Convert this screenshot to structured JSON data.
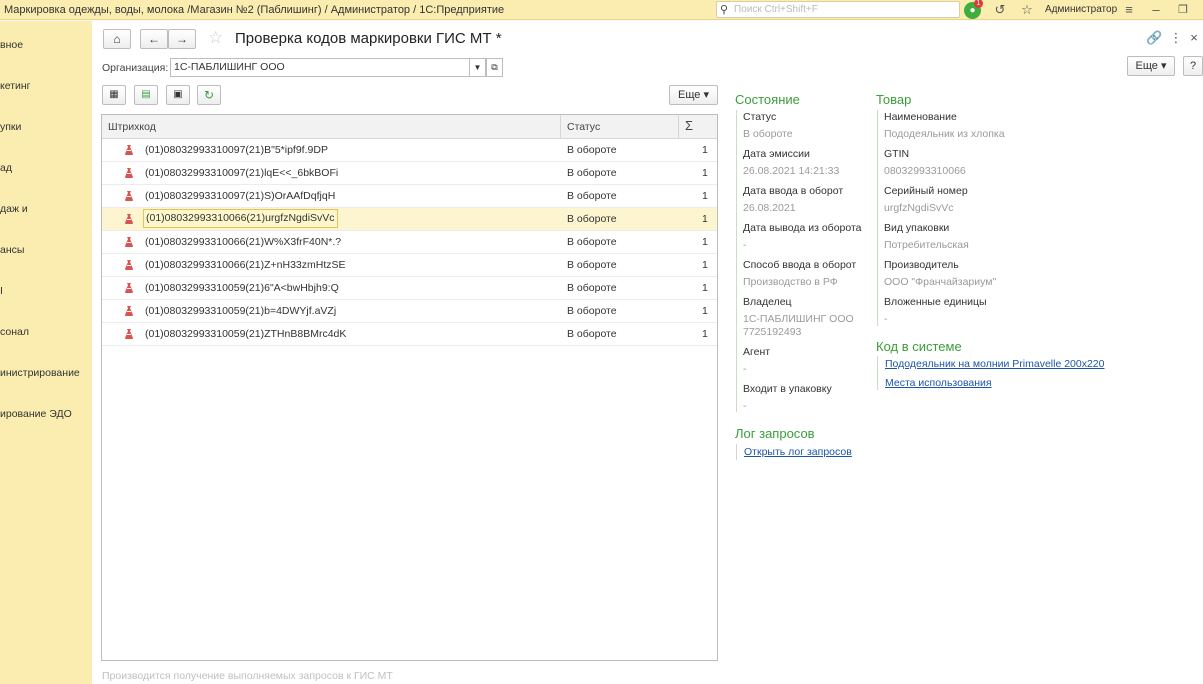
{
  "window": {
    "title": "Маркировка одежды, воды, молока /Магазин №2 (Паблишинг) / Администратор / 1С:Предприятие",
    "search_placeholder": "Поиск Ctrl+Shift+F",
    "user": "Администратор",
    "notifications_count": "1"
  },
  "sidebar": {
    "items": [
      {
        "label": "вное"
      },
      {
        "label": "кетинг"
      },
      {
        "label": "упки"
      },
      {
        "label": "ад"
      },
      {
        "label": "даж и"
      },
      {
        "label": "ансы"
      },
      {
        "label": "I"
      },
      {
        "label": "сонал"
      },
      {
        "label": "инистрирование"
      },
      {
        "label": "ирование ЭДО"
      }
    ]
  },
  "form": {
    "title": "Проверка кодов маркировки ГИС МТ *",
    "org_label": "Организация:",
    "org_value": "1С-ПАБЛИШИНГ ООО",
    "more_button": "Еще",
    "more_button_top": "Еще",
    "help_button": "?"
  },
  "table": {
    "columns": [
      "Штрихкод",
      "Статус",
      "Σ"
    ],
    "rows": [
      {
        "code": "(01)08032993310097(21)B\"5*ipf9f.9DP",
        "status": "В обороте",
        "qty": "1",
        "selected": false
      },
      {
        "code": "(01)08032993310097(21)lqE<<_6bkBOFi",
        "status": "В обороте",
        "qty": "1",
        "selected": false
      },
      {
        "code": "(01)08032993310097(21)S)OrAAfDqfjqH",
        "status": "В обороте",
        "qty": "1",
        "selected": false
      },
      {
        "code": "(01)08032993310066(21)urgfzNgdiSvVc",
        "status": "В обороте",
        "qty": "1",
        "selected": true
      },
      {
        "code": "(01)08032993310066(21)W%X3frF40N*.?",
        "status": "В обороте",
        "qty": "1",
        "selected": false
      },
      {
        "code": "(01)08032993310066(21)Z+nH33zmHtzSE",
        "status": "В обороте",
        "qty": "1",
        "selected": false
      },
      {
        "code": "(01)08032993310059(21)6\"A<bwHbjh9:Q",
        "status": "В обороте",
        "qty": "1",
        "selected": false
      },
      {
        "code": "(01)08032993310059(21)b=4DWYjf.aVZj",
        "status": "В обороте",
        "qty": "1",
        "selected": false
      },
      {
        "code": "(01)08032993310059(21)ZTHnB8BMrc4dK",
        "status": "В обороте",
        "qty": "1",
        "selected": false
      }
    ]
  },
  "state": {
    "header": "Состояние",
    "status_label": "Статус",
    "status_value": "В обороте",
    "emission_label": "Дата эмиссии",
    "emission_value": "26.08.2021 14:21:33",
    "in_date_label": "Дата ввода в оборот",
    "in_date_value": "26.08.2021",
    "out_date_label": "Дата вывода из оборота",
    "out_date_value": "-",
    "method_label": "Способ ввода в оборот",
    "method_value": "Производство в РФ",
    "owner_label": "Владелец",
    "owner_value": "1С-ПАБЛИШИНГ ООО",
    "owner_inn": "7725192493",
    "agent_label": "Агент",
    "agent_value": "-",
    "pack_label": "Входит в упаковку",
    "pack_value": "-"
  },
  "product": {
    "header": "Товар",
    "name_label": "Наименование",
    "name_value": "Пододеяльник из хлопка",
    "gtin_label": "GTIN",
    "gtin_value": "08032993310066",
    "serial_label": "Серийный номер",
    "serial_value": "urgfzNgdiSvVc",
    "package_label": "Вид упаковки",
    "package_value": "Потребительская",
    "producer_label": "Производитель",
    "producer_value": "ООО \"Франчайзариум\"",
    "nested_label": "Вложенные единицы",
    "nested_value": "-"
  },
  "system": {
    "header": "Код в системе",
    "link1": "Пододеяльник на молнии Primavelle 200x220",
    "link2": "Места использования"
  },
  "log": {
    "header": "Лог запросов",
    "link": "Открыть лог запросов"
  },
  "footer": {
    "text": "Производится получение выполняемых запросов к ГИС МТ"
  }
}
